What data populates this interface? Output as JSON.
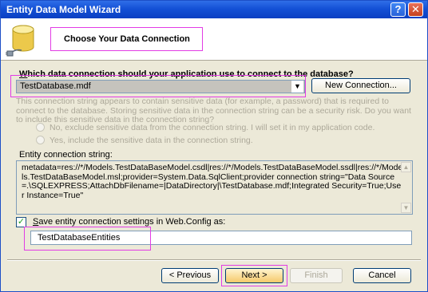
{
  "window": {
    "title": "Entity Data Model Wizard",
    "help_glyph": "?",
    "close_glyph": "✕"
  },
  "header": {
    "title": "Choose Your Data Connection"
  },
  "connection": {
    "question_prefix": "",
    "question_underlined": "W",
    "question_rest": "hich data connection should your application use to connect to the database?",
    "selected": "TestDatabase.mdf",
    "new_connection_label": "New Connection..."
  },
  "sensitive": {
    "description": "This connection string appears to contain sensitive data (for example, a password) that is required to connect to the database. Storing sensitive data in the connection string can be a security risk. Do you want to include this sensitive data in the connection string?",
    "option_exclude": "No, exclude sensitive data from the connection string. I will set it in my application code.",
    "option_include": "Yes, include the sensitive data in the connection string."
  },
  "entity": {
    "label": "Entity connection string:",
    "value": "metadata=res://*/Models.TestDataBaseModel.csdl|res://*/Models.TestDataBaseModel.ssdl|res://*/Models.TestDataBaseModel.msl;provider=System.Data.SqlClient;provider connection string=\"Data Source=.\\SQLEXPRESS;AttachDbFilename=|DataDirectory|\\TestDatabase.mdf;Integrated Security=True;User Instance=True\""
  },
  "save": {
    "checked": "✓",
    "label_underlined": "S",
    "label_rest": "ave entity connection settings in Web.Config as:",
    "value": "TestDatabaseEntities"
  },
  "buttons": {
    "previous": "< Previous",
    "next": "Next >",
    "finish": "Finish",
    "cancel": "Cancel"
  }
}
